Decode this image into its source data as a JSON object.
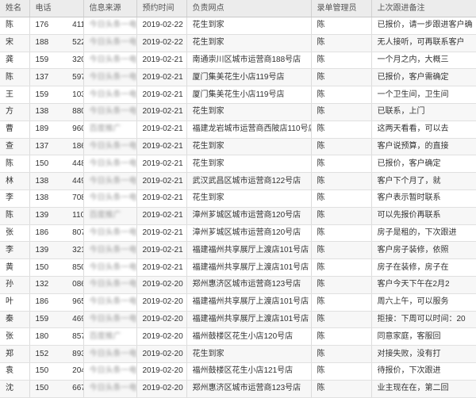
{
  "table": {
    "headers": [
      "姓名",
      "电话",
      "信息来源",
      "预约时间",
      "负责网点",
      "录单管理员",
      "上次跟进备注"
    ],
    "rows": [
      {
        "name": "陈",
        "phone": "176　　　4118",
        "source": "今日头条一电话",
        "date": "2019-02-22",
        "store": "花生到家",
        "admin": "陈",
        "note": "已报价，请一步跟进客户确"
      },
      {
        "name": "宋",
        "phone": "188　　　5228",
        "source": "今日头条一电话",
        "date": "2019-02-22",
        "store": "花生到家",
        "admin": "陈",
        "note": "无人接听，可再联系客户"
      },
      {
        "name": "龚",
        "phone": "159　　　3201",
        "source": "今日头条一电话",
        "date": "2019-02-21",
        "store": "南通崇川区城市运营商188号店",
        "admin": "陈",
        "note": "一个月之内，大概三"
      },
      {
        "name": "陈",
        "phone": "137　　　5979",
        "source": "今日头条一电话",
        "date": "2019-02-21",
        "store": "厦门集美花生小店119号店",
        "admin": "陈",
        "note": "已报价，客户需确定"
      },
      {
        "name": "王",
        "phone": "159　　　1031",
        "source": "今日头条一电话",
        "date": "2019-02-21",
        "store": "厦门集美花生小店119号店",
        "admin": "陈",
        "note": "一个卫生间，卫生间"
      },
      {
        "name": "方",
        "phone": "138　　　8800",
        "source": "今日头条一电话",
        "date": "2019-02-21",
        "store": "花生到家",
        "admin": "陈",
        "note": "已联系，上门"
      },
      {
        "name": "曹",
        "phone": "189　　　9602",
        "source": "百度推广",
        "date": "2019-02-21",
        "store": "福建龙岩城市运营商西陂店110号店",
        "admin": "陈",
        "note": "这两天看看，可以去"
      },
      {
        "name": "查",
        "phone": "137　　　1866",
        "source": "今日头条一电话",
        "date": "2019-02-21",
        "store": "花生到家",
        "admin": "陈",
        "note": "客户说预算，的直接"
      },
      {
        "name": "陈",
        "phone": "150　　　4484",
        "source": "今日头条一电话",
        "date": "2019-02-21",
        "store": "花生到家",
        "admin": "陈",
        "note": "已报价，客户确定"
      },
      {
        "name": "林",
        "phone": "138　　　4497",
        "source": "今日头条一电话",
        "date": "2019-02-21",
        "store": "武汉武昌区城市运营商122号店",
        "admin": "陈",
        "note": "客户下个月了，就"
      },
      {
        "name": "李",
        "phone": "138　　　7084",
        "source": "今日头条一电话",
        "date": "2019-02-21",
        "store": "花生到家",
        "admin": "陈",
        "note": "客户表示暂时联系"
      },
      {
        "name": "陈",
        "phone": "139　　　1108",
        "source": "百度推广",
        "date": "2019-02-21",
        "store": "漳州芗城区城市运营商120号店",
        "admin": "陈",
        "note": "可以先报价再联系"
      },
      {
        "name": "张",
        "phone": "186　　　8071",
        "source": "今日头条一电话",
        "date": "2019-02-21",
        "store": "漳州芗城区城市运营商120号店",
        "admin": "陈",
        "note": "房子是租的，下次跟进"
      },
      {
        "name": "李",
        "phone": "139　　　3218",
        "source": "今日头条一电话",
        "date": "2019-02-21",
        "store": "福建福州共享展厅上渡店101号店",
        "admin": "陈",
        "note": "客户房子装修，依照"
      },
      {
        "name": "黄",
        "phone": "150　　　8508",
        "source": "今日头条一电话",
        "date": "2019-02-21",
        "store": "福建福州共享展厅上渡店101号店",
        "admin": "陈",
        "note": "房子在装修，房子在"
      },
      {
        "name": "孙",
        "phone": "132　　　0868",
        "source": "今日头条一电话",
        "date": "2019-02-20",
        "store": "郑州惠济区城市运营商123号店",
        "admin": "陈",
        "note": "客户今天下午在2月2"
      },
      {
        "name": "叶",
        "phone": "186　　　9654",
        "source": "今日头条一电话",
        "date": "2019-02-20",
        "store": "福建福州共享展厅上渡店101号店",
        "admin": "陈",
        "note": "周六上午，可以服务"
      },
      {
        "name": "秦",
        "phone": "159　　　4699",
        "source": "今日头条一电话",
        "date": "2019-02-20",
        "store": "福建福州共享展厅上渡店101号店",
        "admin": "陈",
        "note": "拒接：下周可以时间：20"
      },
      {
        "name": "张",
        "phone": "180　　　8579",
        "source": "百度推广",
        "date": "2019-02-20",
        "store": "福州鼓楼区花生小店120号店",
        "admin": "陈",
        "note": "同意家庭，客服回"
      },
      {
        "name": "郑",
        "phone": "152　　　8939",
        "source": "今日头条一电话",
        "date": "2019-02-20",
        "store": "花生到家",
        "admin": "陈",
        "note": "对接失败，没有打"
      },
      {
        "name": "袁",
        "phone": "150　　　2043",
        "source": "今日头条一电话",
        "date": "2019-02-20",
        "store": "福州鼓楼区花生小店121号店",
        "admin": "陈",
        "note": "待报价，下次跟进"
      },
      {
        "name": "沈",
        "phone": "150　　　6678",
        "source": "今日头条一电话",
        "date": "2019-02-20",
        "store": "郑州惠济区城市运营商123号店",
        "admin": "陈",
        "note": "业主现在在，第二回"
      }
    ]
  }
}
